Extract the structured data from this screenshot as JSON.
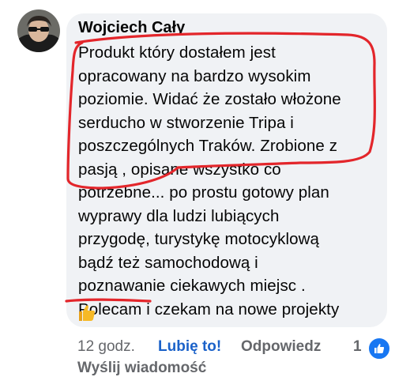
{
  "comment": {
    "author": "Wojciech Cały",
    "text_lines": [
      "Produkt który dostałem jest",
      "opracowany na bardzo wysokim",
      "poziomie. Widać że zostało włożone",
      "serducho w stworzenie Tripa i",
      "poszczególnych Traków. Zrobione z",
      "pasją , opisane wszystko co",
      "potrzebne... po prostu gotowy plan",
      "wyprawy dla ludzi lubiących",
      "przygodę, turystykę motocyklową",
      "bądź też samochodową i",
      "poznawanie ciekawych miejsc .",
      "Polecam i czekam na nowe projekty"
    ],
    "emoji": "thumbs-up-emoji"
  },
  "actions": {
    "time": "12 godz.",
    "like_label": "Lubię to!",
    "reply_label": "Odpowiedz",
    "reaction_count": "1"
  },
  "footer": {
    "send_message_label": "Wyślij wiadomość"
  },
  "colors": {
    "bubble": "#f0f2f5",
    "like_blue": "#1b62c9",
    "annotation_red": "#e3262b"
  }
}
